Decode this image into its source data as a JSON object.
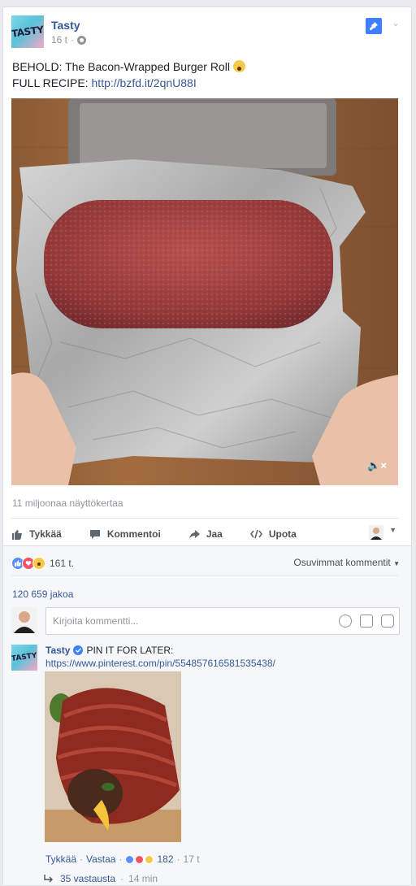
{
  "post": {
    "page_name": "Tasty",
    "logo_text": "TASTY",
    "time": "16 t",
    "text_line1": "BEHOLD: The Bacon-Wrapped Burger Roll",
    "text_line2_prefix": "FULL RECIPE: ",
    "link": "http://bzfd.it/2qnU88I",
    "views": "11 miljoonaa näyttökertaa"
  },
  "actions": {
    "like": "Tykkää",
    "comment": "Kommentoi",
    "share": "Jaa",
    "embed": "Upota"
  },
  "stats": {
    "reactions": "161 t.",
    "relevance": "Osuvimmat kommentit",
    "shares": "120 659 jakoa"
  },
  "comment_input": {
    "placeholder": "Kirjoita kommentti..."
  },
  "comment": {
    "author": "Tasty",
    "text": "PIN IT FOR LATER:",
    "link": "https://www.pinterest.com/pin/554857616581535438/",
    "like_label": "Tykkää",
    "reply_label": "Vastaa",
    "reaction_count": "182",
    "time": "17 t",
    "replies_label": "35 vastausta",
    "replies_time": "14 min"
  },
  "colors": {
    "link": "#365899",
    "accent": "#4080ff"
  }
}
